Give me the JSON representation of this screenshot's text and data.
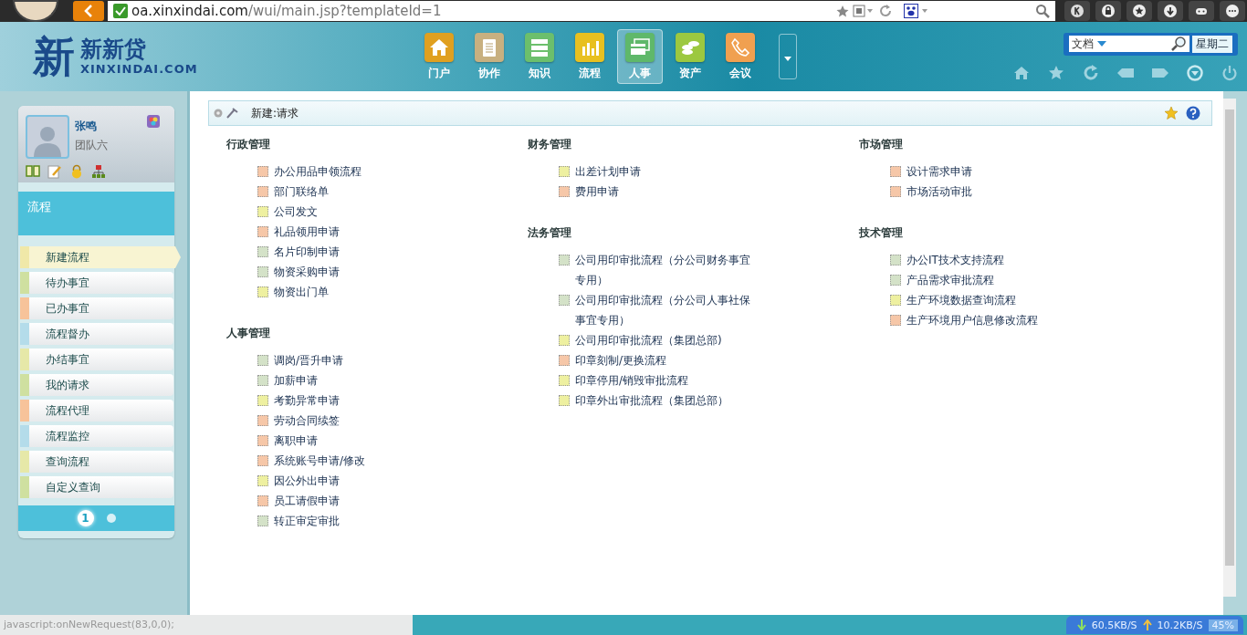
{
  "browser": {
    "url_host": "oa.xinxindai.com",
    "url_path": "/wui/main.jsp?templateId=1"
  },
  "header": {
    "logo_mark": "新",
    "logo_cn": "新新贷",
    "logo_en": "XINXINDAI.COM",
    "nav": [
      {
        "label": "门户",
        "kind": "home",
        "selected": false
      },
      {
        "label": "协作",
        "kind": "clipboard",
        "selected": false
      },
      {
        "label": "知识",
        "kind": "server",
        "selected": false
      },
      {
        "label": "流程",
        "kind": "chart",
        "selected": false
      },
      {
        "label": "人事",
        "kind": "cards",
        "selected": true
      },
      {
        "label": "资产",
        "kind": "coins",
        "selected": false
      },
      {
        "label": "会议",
        "kind": "phone",
        "selected": false
      }
    ],
    "search": {
      "category": "文档",
      "weekday": "星期二"
    }
  },
  "user": {
    "name": "张鸣",
    "team": "团队六"
  },
  "sidebar": {
    "section": "流程",
    "items": [
      {
        "label": "新建流程",
        "color": "#f0e8a8",
        "selected": true
      },
      {
        "label": "待办事宜",
        "color": "#cfe0a0",
        "selected": false
      },
      {
        "label": "已办事宜",
        "color": "#f7c39a",
        "selected": false
      },
      {
        "label": "流程督办",
        "color": "#b4dcea",
        "selected": false
      },
      {
        "label": "办结事宜",
        "color": "#e6e8a8",
        "selected": false
      },
      {
        "label": "我的请求",
        "color": "#cfe0a0",
        "selected": false
      },
      {
        "label": "流程代理",
        "color": "#f7c39a",
        "selected": false
      },
      {
        "label": "流程监控",
        "color": "#b4dcea",
        "selected": false
      },
      {
        "label": "查询流程",
        "color": "#e6e8a8",
        "selected": false
      },
      {
        "label": "自定义查询",
        "color": "#cfe0a0",
        "selected": false
      }
    ],
    "pager": [
      {
        "label": "1",
        "selected": true
      },
      {
        "selected": false
      }
    ]
  },
  "content": {
    "title": "新建:请求",
    "columns": [
      [
        {
          "name": "行政管理",
          "items": [
            {
              "label": "办公用品申领流程",
              "color": "#f6c7a8"
            },
            {
              "label": "部门联络单",
              "color": "#f6c7a8"
            },
            {
              "label": "公司发文",
              "color": "#eef0a0"
            },
            {
              "label": "礼品领用申请",
              "color": "#f6c7a8"
            },
            {
              "label": "名片印制申请",
              "color": "#d4e2c8"
            },
            {
              "label": "物资采购申请",
              "color": "#d4e2c8"
            },
            {
              "label": "物资出门单",
              "color": "#eef0a0"
            }
          ]
        },
        {
          "name": "人事管理",
          "items": [
            {
              "label": "调岗/晋升申请",
              "color": "#d4e2c8"
            },
            {
              "label": "加薪申请",
              "color": "#d4e2c8"
            },
            {
              "label": "考勤异常申请",
              "color": "#eef0a0"
            },
            {
              "label": "劳动合同续签",
              "color": "#f6c7a8"
            },
            {
              "label": "离职申请",
              "color": "#f6c7a8"
            },
            {
              "label": "系统账号申请/修改",
              "color": "#f6c7a8"
            },
            {
              "label": "因公外出申请",
              "color": "#eef0a0"
            },
            {
              "label": "员工请假申请",
              "color": "#f6c7a8"
            },
            {
              "label": "转正审定审批",
              "color": "#d4e2c8"
            }
          ]
        }
      ],
      [
        {
          "name": "财务管理",
          "items": [
            {
              "label": "出差计划申请",
              "color": "#eef0a0"
            },
            {
              "label": "费用申请",
              "color": "#f6c7a8"
            }
          ]
        },
        {
          "name": "法务管理",
          "items": [
            {
              "label": "公司用印审批流程（分公司财务事宜专用）",
              "color": "#d4e2c8"
            },
            {
              "label": "公司用印审批流程（分公司人事社保事宜专用）",
              "color": "#d4e2c8"
            },
            {
              "label": "公司用印审批流程（集团总部)",
              "color": "#eef0a0"
            },
            {
              "label": "印章刻制/更换流程",
              "color": "#f6c7a8"
            },
            {
              "label": "印章停用/销毁审批流程",
              "color": "#eef0a0"
            },
            {
              "label": "印章外出审批流程（集团总部）",
              "color": "#eef0a0"
            }
          ]
        }
      ],
      [
        {
          "name": "市场管理",
          "items": [
            {
              "label": "设计需求申请",
              "color": "#f6c7a8"
            },
            {
              "label": "市场活动审批",
              "color": "#f6c7a8"
            }
          ]
        },
        {
          "name": "技术管理",
          "items": [
            {
              "label": "办公IT技术支持流程",
              "color": "#d4e2c8"
            },
            {
              "label": "产品需求审批流程",
              "color": "#d4e2c8"
            },
            {
              "label": "生产环境数据查询流程",
              "color": "#eef0a0"
            },
            {
              "label": "生产环境用户信息修改流程",
              "color": "#f6c7a8"
            }
          ]
        }
      ]
    ]
  },
  "status": {
    "link": "javascript:onNewRequest(83,0,0);",
    "down": "60.5KB/S",
    "up": "10.2KB/S",
    "percent": "45%"
  }
}
